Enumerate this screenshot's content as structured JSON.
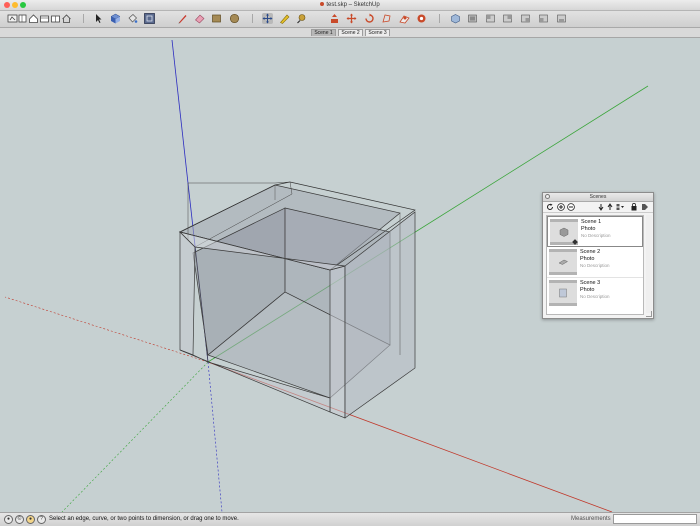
{
  "window": {
    "title": "test.skp – SketchUp",
    "traffic_lights": [
      "#ff5f57",
      "#febc2e",
      "#28c840"
    ]
  },
  "toolbar": {
    "tools": [
      "cube-icon",
      "rectangle-icon",
      "home-icon",
      "floor-plan-icon",
      "pencil-box-icon",
      "house-outline-icon",
      "select-arrow-icon",
      "make-component-icon",
      "paint-bucket-icon",
      "section-plane-icon",
      "line-pencil-icon",
      "eraser-icon",
      "rectangle-shape-icon",
      "circle-icon",
      "move-tool-icon",
      "measure-tape-icon",
      "follow-me-icon",
      "push-pull-icon",
      "rotate-icon",
      "offset-icon",
      "orbit-icon",
      "iso-view-icon",
      "top-view-icon",
      "front-view-icon",
      "right-view-icon",
      "back-view-icon",
      "left-view-icon"
    ]
  },
  "scene_tabs": [
    {
      "label": "Scene 1",
      "active": true
    },
    {
      "label": "Scene 2",
      "active": false
    },
    {
      "label": "Scene 3",
      "active": false
    }
  ],
  "scenes_panel": {
    "title": "Scenes",
    "tools": [
      "refresh-icon",
      "add-scene-icon",
      "remove-scene-icon",
      "move-down-icon",
      "move-up-icon",
      "view-options-icon",
      "filter-icon",
      "details-icon"
    ],
    "items": [
      {
        "name": "Scene 1",
        "style": "Photo",
        "description": "No Description",
        "selected": true
      },
      {
        "name": "Scene 2",
        "style": "Photo",
        "description": "No Description",
        "selected": false
      },
      {
        "name": "Scene 3",
        "style": "Photo",
        "description": "No Description",
        "selected": false
      }
    ]
  },
  "status": {
    "icons": [
      "geo-location-icon",
      "credits-icon",
      "user-icon"
    ],
    "message": "Select an edge, curve, or two points to dimension, or drag one to move.",
    "measurements_label": "Measurements",
    "measurements_value": ""
  },
  "colors": {
    "background": "#c6d0d1",
    "axis_red": "#c0392b",
    "axis_green": "#3aa53a",
    "axis_blue": "#2b2bc0"
  }
}
